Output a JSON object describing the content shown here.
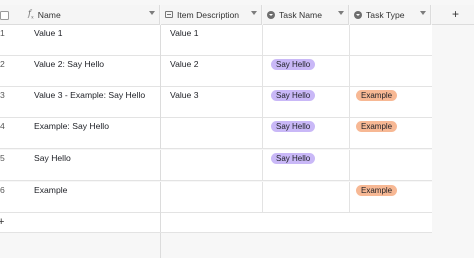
{
  "header": {
    "name_label": "Name",
    "desc_label": "Item Description",
    "task_label": "Task Name",
    "type_label": "Task Type",
    "add_label": "+"
  },
  "rows": [
    {
      "num": "1",
      "name": "Value 1",
      "desc": "Value 1",
      "task": "",
      "type": ""
    },
    {
      "num": "2",
      "name": "Value 2: Say Hello",
      "desc": "Value 2",
      "task": "Say Hello",
      "type": ""
    },
    {
      "num": "3",
      "name": "Value 3 - Example: Say Hello",
      "desc": "Value 3",
      "task": "Say Hello",
      "type": "Example"
    },
    {
      "num": "4",
      "name": "Example: Say Hello",
      "desc": "",
      "task": "Say Hello",
      "type": "Example"
    },
    {
      "num": "5",
      "name": "Say Hello",
      "desc": "",
      "task": "Say Hello",
      "type": ""
    },
    {
      "num": "6",
      "name": "Example",
      "desc": "",
      "task": "",
      "type": "Example"
    }
  ],
  "add_row_label": "+",
  "colors": {
    "task_pill": "#c9b8f7",
    "type_pill": "#f7b894",
    "row_bg": "#ffffff",
    "grid_bg": "#f7f7f7"
  },
  "icons": {
    "name_field": "formula-icon",
    "desc_field": "long-text-icon",
    "task_field": "single-select-icon",
    "type_field": "single-select-icon"
  }
}
